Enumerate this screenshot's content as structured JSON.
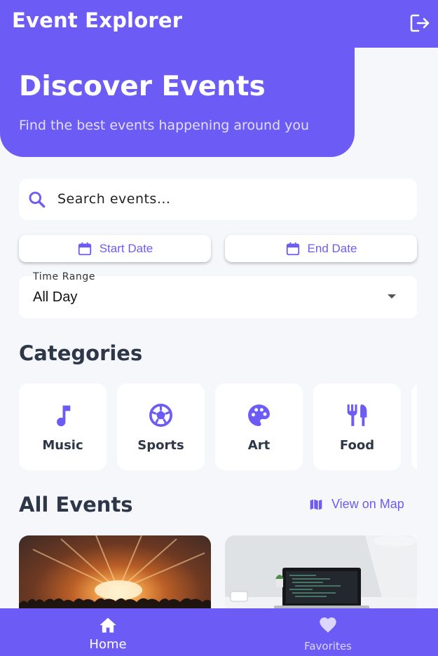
{
  "app": {
    "title": "Event Explorer"
  },
  "hero": {
    "title": "Discover Events",
    "subtitle": "Find the best events happening around you"
  },
  "search": {
    "placeholder": "Search events..."
  },
  "filters": {
    "start_date_label": "Start Date",
    "end_date_label": "End Date",
    "time_range_label": "Time Range",
    "time_range_value": "All Day"
  },
  "categories": {
    "title": "Categories",
    "items": [
      {
        "label": "Music",
        "icon": "music-note-icon"
      },
      {
        "label": "Sports",
        "icon": "soccer-ball-icon"
      },
      {
        "label": "Art",
        "icon": "palette-icon"
      },
      {
        "label": "Food",
        "icon": "restaurant-icon"
      }
    ]
  },
  "events": {
    "title": "All Events",
    "map_link_label": "View on Map",
    "cards": [
      {
        "image": "concert-crowd-image"
      },
      {
        "image": "laptop-desk-image"
      }
    ]
  },
  "nav": {
    "items": [
      {
        "label": "Home",
        "icon": "home-icon",
        "active": true
      },
      {
        "label": "Favorites",
        "icon": "heart-icon",
        "active": false
      }
    ]
  },
  "colors": {
    "primary": "#6c5cf5",
    "background": "#f6f7fb",
    "text_dark": "#2d3748"
  }
}
